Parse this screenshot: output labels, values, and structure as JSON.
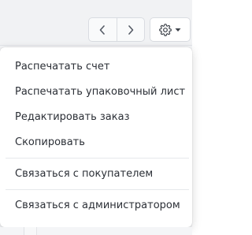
{
  "toolbar": {
    "prev_icon": "chevron-left-icon",
    "next_icon": "chevron-right-icon",
    "settings_icon": "gear-icon",
    "settings_caret_icon": "caret-down-icon"
  },
  "menu": {
    "items": [
      {
        "label": "Распечатать счет"
      },
      {
        "label": "Распечатать упаковочный лист"
      },
      {
        "label": "Редактировать заказ"
      },
      {
        "label": "Скопировать"
      },
      {
        "label": "Связаться с покупателем"
      },
      {
        "label": "Связаться с администратором"
      }
    ]
  },
  "colors": {
    "menu_background": "#ffffff",
    "menu_text": "#2b2f36",
    "divider": "#e6e8eb",
    "toolbar_background": "#f1f2f4",
    "button_border": "#d9dce1"
  }
}
